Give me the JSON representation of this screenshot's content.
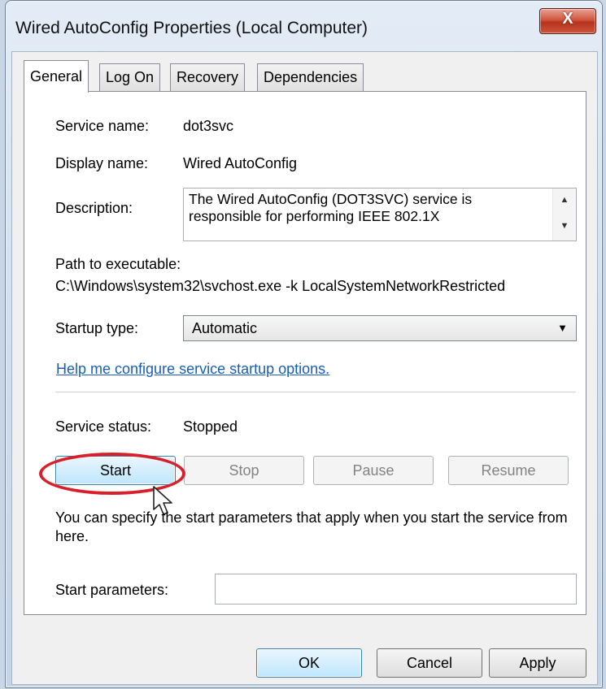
{
  "window": {
    "title": "Wired AutoConfig Properties (Local Computer)",
    "close_glyph": "X"
  },
  "tabs": [
    {
      "label": "General",
      "active": true
    },
    {
      "label": "Log On"
    },
    {
      "label": "Recovery"
    },
    {
      "label": "Dependencies"
    }
  ],
  "general": {
    "service_name_label": "Service name:",
    "service_name": "dot3svc",
    "display_name_label": "Display name:",
    "display_name": "Wired AutoConfig",
    "description_label": "Description:",
    "description": "The Wired AutoConfig (DOT3SVC) service is responsible for performing IEEE 802.1X",
    "path_label": "Path to executable:",
    "path": "C:\\Windows\\system32\\svchost.exe -k LocalSystemNetworkRestricted",
    "startup_type_label": "Startup type:",
    "startup_type": "Automatic",
    "help_link": "Help me configure service startup options.",
    "service_status_label": "Service status:",
    "service_status": "Stopped",
    "buttons": {
      "start": "Start",
      "stop": "Stop",
      "pause": "Pause",
      "resume": "Resume"
    },
    "params_note": "You can specify the start parameters that apply when you start the service from here.",
    "start_params_label": "Start parameters:",
    "start_params_value": ""
  },
  "footer": {
    "ok": "OK",
    "cancel": "Cancel",
    "apply": "Apply"
  },
  "icons": {
    "scroll_up": "▲",
    "scroll_down": "▼",
    "dropdown": "▼",
    "cursor": "arrow-pointer-icon"
  },
  "colors": {
    "link": "#1a5fae",
    "highlight_ring": "#d8202a",
    "close_button": "#c9432b"
  }
}
